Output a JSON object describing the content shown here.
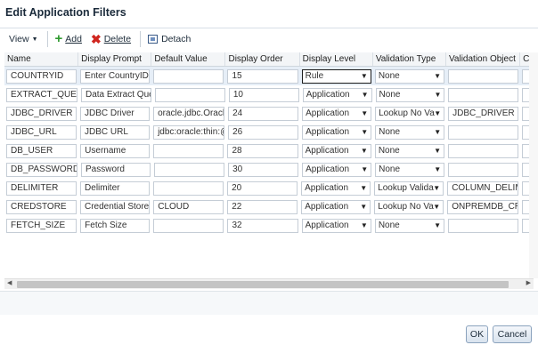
{
  "dialog": {
    "title": "Edit Application Filters"
  },
  "toolbar": {
    "view_label": "View",
    "add_label": "Add",
    "delete_label": "Delete",
    "detach_label": "Detach"
  },
  "table": {
    "columns": [
      "Name",
      "Display Prompt",
      "Default Value",
      "Display Order",
      "Display Level",
      "Validation Type",
      "Validation Object",
      "Co"
    ],
    "rows": [
      {
        "name": "COUNTRYID",
        "prompt": "Enter CountryID",
        "default": "",
        "order": "15",
        "level": "Rule",
        "vtype": "None",
        "vobject": ""
      },
      {
        "name": "EXTRACT_QUERY",
        "prompt": "Data Extract Query",
        "default": "",
        "order": "10",
        "level": "Application",
        "vtype": "None",
        "vobject": ""
      },
      {
        "name": "JDBC_DRIVER",
        "prompt": "JDBC Driver",
        "default": "oracle.jdbc.OracleD",
        "order": "24",
        "level": "Application",
        "vtype": "Lookup No Va",
        "vobject": "JDBC_DRIVER"
      },
      {
        "name": "JDBC_URL",
        "prompt": "JDBC URL",
        "default": "jdbc:oracle:thin:@",
        "order": "26",
        "level": "Application",
        "vtype": "None",
        "vobject": ""
      },
      {
        "name": "DB_USER",
        "prompt": "Username",
        "default": "",
        "order": "28",
        "level": "Application",
        "vtype": "None",
        "vobject": ""
      },
      {
        "name": "DB_PASSWORD",
        "prompt": "Password",
        "default": "",
        "order": "30",
        "level": "Application",
        "vtype": "None",
        "vobject": ""
      },
      {
        "name": "DELIMITER",
        "prompt": "Delimiter",
        "default": "",
        "order": "20",
        "level": "Application",
        "vtype": "Lookup Valida",
        "vobject": "COLUMN_DELIMIT"
      },
      {
        "name": "CREDSTORE",
        "prompt": "Credential Store",
        "default": "CLOUD",
        "order": "22",
        "level": "Application",
        "vtype": "Lookup No Va",
        "vobject": "ONPREMDB_CRED"
      },
      {
        "name": "FETCH_SIZE",
        "prompt": "Fetch Size",
        "default": "",
        "order": "32",
        "level": "Application",
        "vtype": "None",
        "vobject": ""
      }
    ]
  },
  "buttons": {
    "ok_label": "OK",
    "cancel_label": "Cancel"
  }
}
